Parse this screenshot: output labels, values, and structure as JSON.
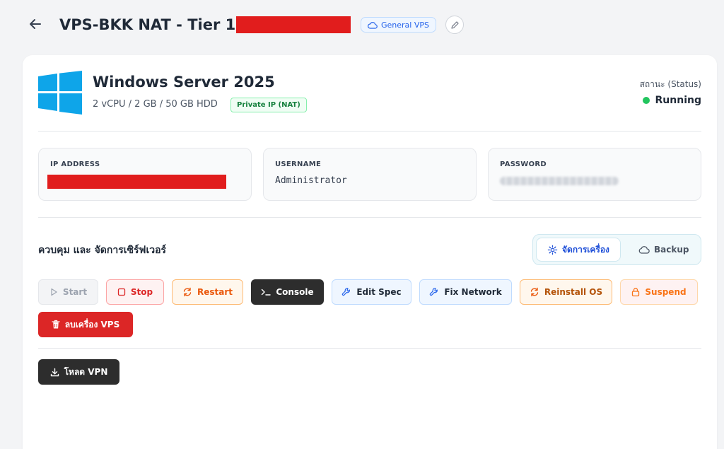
{
  "header": {
    "title": "VPS-BKK NAT - Tier 1",
    "badge": "General VPS"
  },
  "server": {
    "os_name": "Windows Server 2025",
    "spec": "2 vCPU / 2 GB / 50 GB HDD",
    "ip_type_badge": "Private IP (NAT)",
    "status_label": "สถานะ (Status)",
    "status_value": "Running",
    "status_color": "#22c55e"
  },
  "credentials": {
    "ip_label": "IP ADDRESS",
    "username_label": "USERNAME",
    "username_value": "Administrator",
    "password_label": "PASSWORD"
  },
  "controls": {
    "section_title": "ควบคุม และ จัดการเซิร์ฟเวอร์",
    "tabs": [
      {
        "label": "จัดการเครื่อง",
        "icon": "gear-icon",
        "active": true
      },
      {
        "label": "Backup",
        "icon": "cloud-icon",
        "active": false
      }
    ],
    "buttons": {
      "start": "Start",
      "stop": "Stop",
      "restart": "Restart",
      "console": "Console",
      "edit_spec": "Edit Spec",
      "fix_network": "Fix Network",
      "reinstall": "Reinstall OS",
      "suspend": "Suspend",
      "delete": "ลบเครื่อง VPS",
      "download_vpn": "โหลด VPN"
    }
  },
  "colors": {
    "accent": "#2563eb",
    "danger": "#dc2626",
    "windows_blue": "#0ea5e9",
    "dark_button": "#2d2d2d"
  }
}
